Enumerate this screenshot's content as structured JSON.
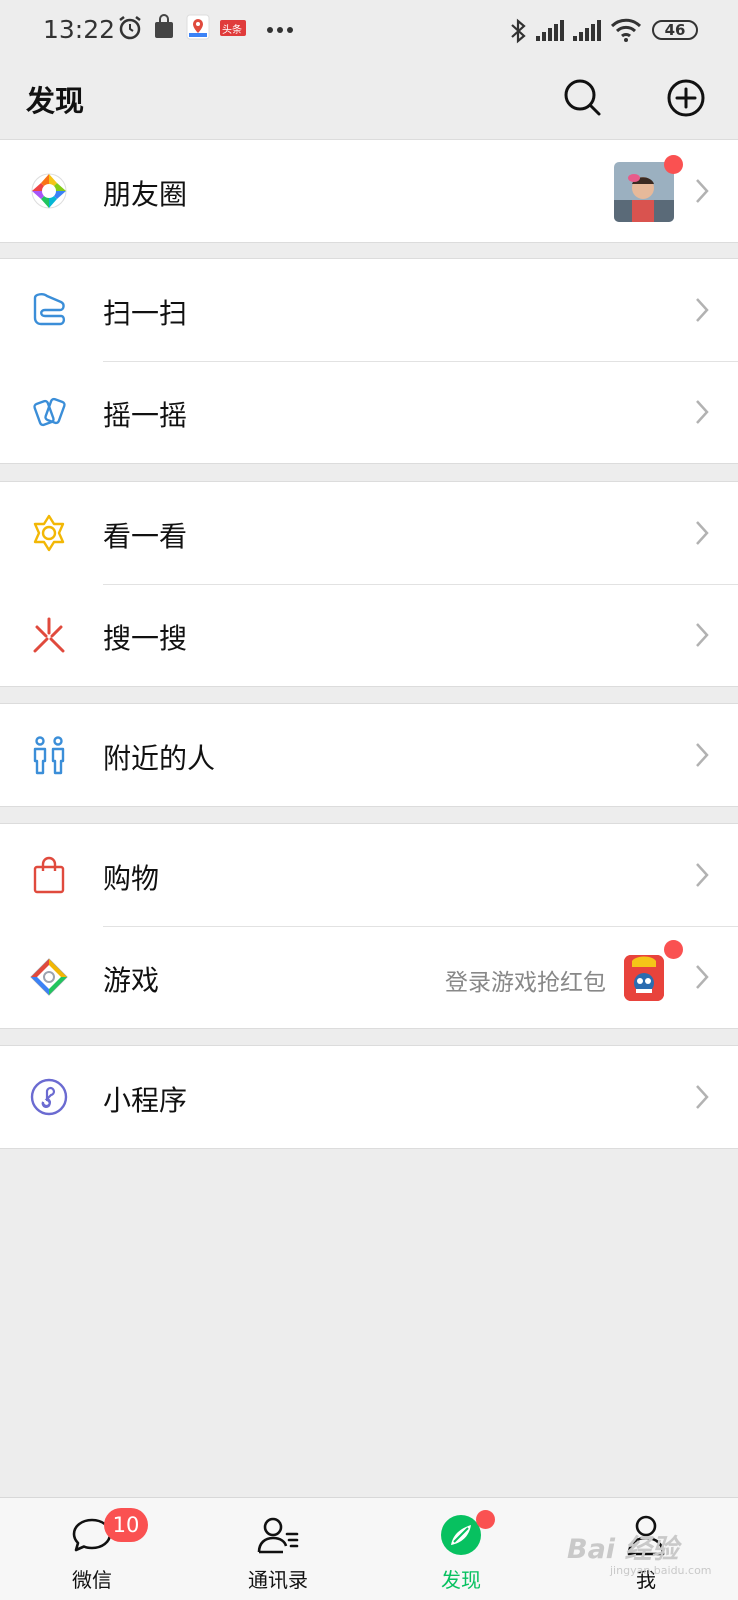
{
  "status_bar": {
    "time": "13:22",
    "battery": "46",
    "toutiao_badge": "头条",
    "icons": [
      "alarm-icon",
      "bag-icon",
      "maps-icon",
      "toutiao-icon",
      "more-dots-icon",
      "bluetooth-icon",
      "signal-icon",
      "signal-icon",
      "wifi-icon",
      "battery-icon"
    ]
  },
  "header": {
    "title": "发现",
    "actions": [
      "search-icon",
      "add-icon"
    ]
  },
  "groups": [
    {
      "items": [
        {
          "label": "朋友圈",
          "icon": "moments-icon",
          "has_thumbnail": true,
          "has_red_dot": true
        }
      ]
    },
    {
      "items": [
        {
          "label": "扫一扫",
          "icon": "scan-icon"
        },
        {
          "label": "摇一摇",
          "icon": "shake-icon"
        }
      ]
    },
    {
      "items": [
        {
          "label": "看一看",
          "icon": "top-stories-icon"
        },
        {
          "label": "搜一搜",
          "icon": "search-search-icon"
        }
      ]
    },
    {
      "items": [
        {
          "label": "附近的人",
          "icon": "people-nearby-icon"
        }
      ]
    },
    {
      "items": [
        {
          "label": "购物",
          "icon": "shopping-icon"
        },
        {
          "label": "游戏",
          "icon": "games-icon",
          "subtitle": "登录游戏抢红包",
          "has_thumbnail": true,
          "has_red_dot": true
        }
      ]
    },
    {
      "items": [
        {
          "label": "小程序",
          "icon": "mini-programs-icon"
        }
      ]
    }
  ],
  "tabbar": {
    "tabs": [
      {
        "label": "微信",
        "icon": "chats-icon",
        "badge": "10"
      },
      {
        "label": "通讯录",
        "icon": "contacts-icon"
      },
      {
        "label": "发现",
        "icon": "discover-icon",
        "active": true,
        "has_red_dot": true
      },
      {
        "label": "我",
        "icon": "me-icon"
      }
    ]
  },
  "watermark": {
    "text": "Bai 经验",
    "sub": "jingyan.baidu.com"
  },
  "colors": {
    "accent": "#07c160",
    "badge": "#fa5151",
    "background": "#ededed"
  }
}
